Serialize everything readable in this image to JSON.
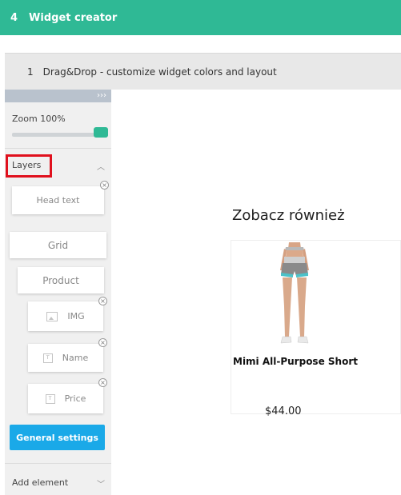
{
  "topbar": {
    "step": "4",
    "title": "Widget creator"
  },
  "section": {
    "step": "1",
    "title": "Drag&Drop - customize widget colors and layout"
  },
  "sidebar": {
    "collapse_glyph": "›››",
    "zoom_label": "Zoom 100%",
    "zoom_value_percent": 100,
    "layers_label": "Layers",
    "layers": {
      "head_text": "Head text",
      "grid": "Grid",
      "product": "Product",
      "img": "IMG",
      "name": "Name",
      "price": "Price"
    },
    "general_settings": "General settings",
    "add_element": "Add element"
  },
  "widget": {
    "title": "Zobacz również",
    "product_name": "Mimi All-Purpose Short",
    "product_price": "$44.00"
  },
  "colors": {
    "brand_green": "#2fb995",
    "button_blue": "#1aa9e8",
    "highlight_red": "#e0101d"
  }
}
